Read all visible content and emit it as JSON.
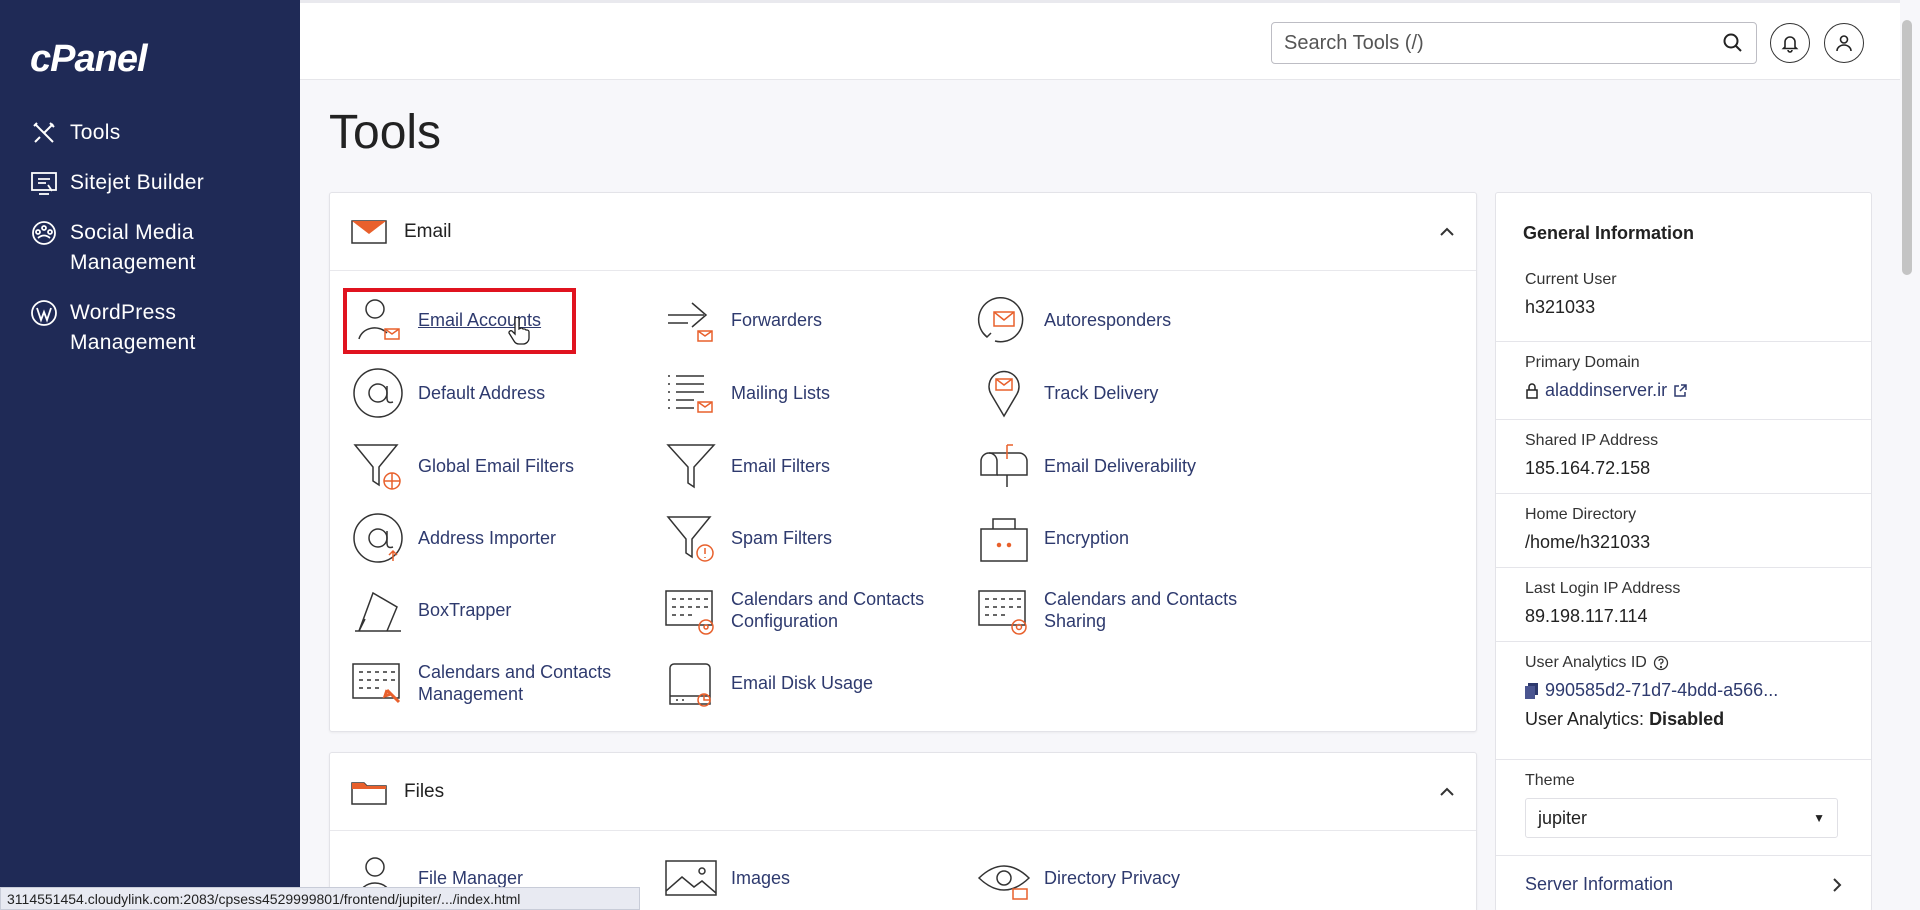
{
  "app": {
    "logo": "cPanel"
  },
  "sidebar": {
    "items": [
      {
        "label": "Tools",
        "icon": "tools-icon"
      },
      {
        "label": "Sitejet Builder",
        "icon": "sitejet-icon"
      },
      {
        "label": "Social Media Management",
        "icon": "social-media-icon"
      },
      {
        "label": "WordPress Management",
        "icon": "wordpress-icon"
      }
    ]
  },
  "header": {
    "search_placeholder": "Search Tools (/)"
  },
  "page": {
    "title": "Tools"
  },
  "email_section": {
    "title": "Email",
    "tools": [
      {
        "label": "Email Accounts",
        "icon": "email-accounts-icon"
      },
      {
        "label": "Forwarders",
        "icon": "forwarders-icon"
      },
      {
        "label": "Autoresponders",
        "icon": "autoresponders-icon"
      },
      {
        "label": "Default Address",
        "icon": "default-address-icon"
      },
      {
        "label": "Mailing Lists",
        "icon": "mailing-lists-icon"
      },
      {
        "label": "Track Delivery",
        "icon": "track-delivery-icon"
      },
      {
        "label": "Global Email Filters",
        "icon": "global-filter-icon"
      },
      {
        "label": "Email Filters",
        "icon": "filter-icon"
      },
      {
        "label": "Email Deliverability",
        "icon": "mailbox-icon"
      },
      {
        "label": "Address Importer",
        "icon": "address-importer-icon"
      },
      {
        "label": "Spam Filters",
        "icon": "spam-filter-icon"
      },
      {
        "label": "Encryption",
        "icon": "encryption-icon"
      },
      {
        "label": "BoxTrapper",
        "icon": "boxtrapper-icon"
      },
      {
        "label": "Calendars and Contacts Configuration",
        "icon": "calendar-config-icon"
      },
      {
        "label": "Calendars and Contacts Sharing",
        "icon": "calendar-sharing-icon"
      },
      {
        "label": "Calendars and Contacts Management",
        "icon": "calendar-management-icon"
      },
      {
        "label": "Email Disk Usage",
        "icon": "disk-usage-icon"
      }
    ]
  },
  "files_section": {
    "title": "Files",
    "tools": [
      {
        "label": "File Manager",
        "icon": "file-manager-icon"
      },
      {
        "label": "Images",
        "icon": "images-icon"
      },
      {
        "label": "Directory Privacy",
        "icon": "directory-privacy-icon"
      }
    ]
  },
  "general_info": {
    "title": "General Information",
    "current_user_label": "Current User",
    "current_user": "h321033",
    "primary_domain_label": "Primary Domain",
    "primary_domain": "aladdinserver.ir",
    "shared_ip_label": "Shared IP Address",
    "shared_ip": "185.164.72.158",
    "home_dir_label": "Home Directory",
    "home_dir": "/home/h321033",
    "last_login_label": "Last Login IP Address",
    "last_login": "89.198.117.114",
    "analytics_id_label": "User Analytics ID",
    "analytics_id": "990585d2-71d7-4bdd-a566...",
    "analytics_status_label": "User Analytics:",
    "analytics_status": "Disabled",
    "theme_label": "Theme",
    "theme_value": "jupiter",
    "server_info_label": "Server Information"
  },
  "status_bar": {
    "url": "3114551454.cloudylink.com:2083/cpsess4529999801/frontend/jupiter/.../index.html"
  },
  "colors": {
    "sidebar": "#1f2a56",
    "accent": "#e8602c",
    "link": "#2e3a6e",
    "highlight": "#e0131f"
  }
}
